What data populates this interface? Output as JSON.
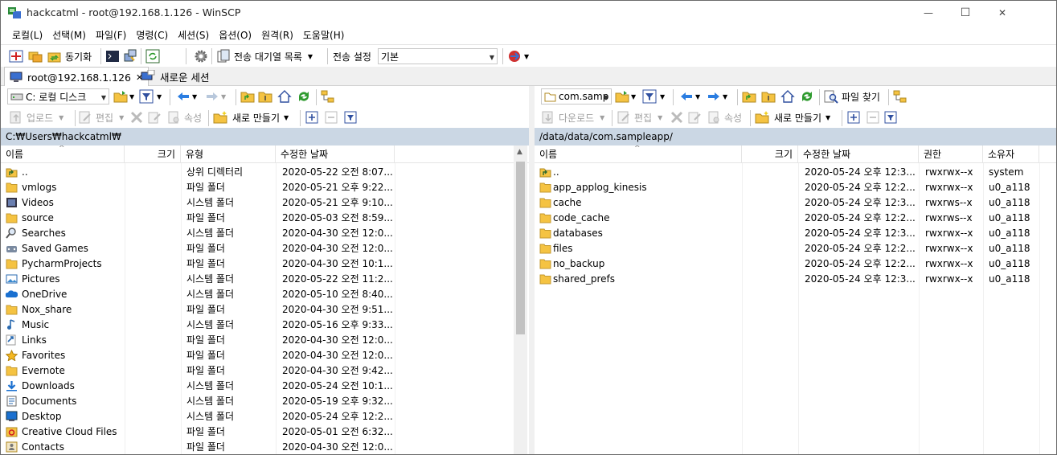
{
  "window": {
    "title": "hackcatml - root@192.168.1.126 - WinSCP",
    "minimize": "—",
    "maximize": "☐",
    "close": "✕"
  },
  "menu": [
    "로컬(L)",
    "선택(M)",
    "파일(F)",
    "명령(C)",
    "세션(S)",
    "옵션(O)",
    "원격(R)",
    "도움말(H)"
  ],
  "toolbar": {
    "sync_label": "동기화",
    "queue_label": "전송 대기열 목록",
    "transfer_settings_label": "전송 설정",
    "transfer_settings_value": "기본"
  },
  "tabs": {
    "session_tab": "root@192.168.1.126",
    "session_close": "✕",
    "new_session": "새로운 세션"
  },
  "left": {
    "drive": "C: 로컬 디스크",
    "upload_label": "업로드",
    "edit_label": "편집",
    "props_label": "속성",
    "new_label": "새로 만들기",
    "path": "C:₩Users₩hackcatml₩",
    "columns": [
      "이름",
      "크기",
      "유형",
      "수정한 날짜"
    ],
    "files": [
      {
        "name": "..",
        "type": "상위 디렉터리",
        "date": "2020-05-22  오전 8:07...",
        "icon": "parent-dir-icon"
      },
      {
        "name": "vmlogs",
        "type": "파일 폴더",
        "date": "2020-05-21  오후 9:22...",
        "icon": "folder-icon"
      },
      {
        "name": "Videos",
        "type": "시스템 폴더",
        "date": "2020-05-21  오후 9:10...",
        "icon": "videos-folder-icon"
      },
      {
        "name": "source",
        "type": "파일 폴더",
        "date": "2020-05-03  오전 8:59...",
        "icon": "folder-icon"
      },
      {
        "name": "Searches",
        "type": "시스템 폴더",
        "date": "2020-04-30  오전 12:0...",
        "icon": "searches-icon"
      },
      {
        "name": "Saved Games",
        "type": "파일 폴더",
        "date": "2020-04-30  오전 12:0...",
        "icon": "saved-games-icon"
      },
      {
        "name": "PycharmProjects",
        "type": "파일 폴더",
        "date": "2020-04-30  오전 10:1...",
        "icon": "folder-icon"
      },
      {
        "name": "Pictures",
        "type": "시스템 폴더",
        "date": "2020-05-22  오전 11:2...",
        "icon": "pictures-icon"
      },
      {
        "name": "OneDrive",
        "type": "시스템 폴더",
        "date": "2020-05-10  오전 8:40...",
        "icon": "onedrive-icon"
      },
      {
        "name": "Nox_share",
        "type": "파일 폴더",
        "date": "2020-04-30  오전 9:51...",
        "icon": "folder-icon"
      },
      {
        "name": "Music",
        "type": "시스템 폴더",
        "date": "2020-05-16  오후 9:33...",
        "icon": "music-icon"
      },
      {
        "name": "Links",
        "type": "파일 폴더",
        "date": "2020-04-30  오전 12:0...",
        "icon": "links-icon"
      },
      {
        "name": "Favorites",
        "type": "파일 폴더",
        "date": "2020-04-30  오전 12:0...",
        "icon": "favorites-icon"
      },
      {
        "name": "Evernote",
        "type": "파일 폴더",
        "date": "2020-04-30  오전 9:42...",
        "icon": "folder-icon"
      },
      {
        "name": "Downloads",
        "type": "시스템 폴더",
        "date": "2020-05-24  오전 10:1...",
        "icon": "downloads-icon"
      },
      {
        "name": "Documents",
        "type": "시스템 폴더",
        "date": "2020-05-19  오후 9:32...",
        "icon": "documents-icon"
      },
      {
        "name": "Desktop",
        "type": "시스템 폴더",
        "date": "2020-05-24  오후 12:2...",
        "icon": "desktop-icon"
      },
      {
        "name": "Creative Cloud Files",
        "type": "파일 폴더",
        "date": "2020-05-01  오전 6:32...",
        "icon": "creative-cloud-icon"
      },
      {
        "name": "Contacts",
        "type": "파일 폴더",
        "date": "2020-04-30  오전 12:0...",
        "icon": "contacts-icon"
      }
    ]
  },
  "right": {
    "dir": "com.samp",
    "download_label": "다운로드",
    "edit_label": "편집",
    "props_label": "속성",
    "new_label": "새로 만들기",
    "find_label": "파일 찾기",
    "path": "/data/data/com.sampleapp/",
    "columns": [
      "이름",
      "크기",
      "수정한 날짜",
      "권한",
      "소유자"
    ],
    "files": [
      {
        "name": "..",
        "date": "2020-05-24  오후 12:3...",
        "perm": "rwxrwx--x",
        "owner": "system",
        "icon": "parent-dir-icon"
      },
      {
        "name": "app_applog_kinesis",
        "date": "2020-05-24  오후 12:2...",
        "perm": "rwxrwx--x",
        "owner": "u0_a118",
        "icon": "folder-icon"
      },
      {
        "name": "cache",
        "date": "2020-05-24  오후 12:3...",
        "perm": "rwxrws--x",
        "owner": "u0_a118",
        "icon": "folder-icon"
      },
      {
        "name": "code_cache",
        "date": "2020-05-24  오후 12:2...",
        "perm": "rwxrws--x",
        "owner": "u0_a118",
        "icon": "folder-icon"
      },
      {
        "name": "databases",
        "date": "2020-05-24  오후 12:3...",
        "perm": "rwxrwx--x",
        "owner": "u0_a118",
        "icon": "folder-icon"
      },
      {
        "name": "files",
        "date": "2020-05-24  오후 12:2...",
        "perm": "rwxrwx--x",
        "owner": "u0_a118",
        "icon": "folder-icon"
      },
      {
        "name": "no_backup",
        "date": "2020-05-24  오후 12:2...",
        "perm": "rwxrwx--x",
        "owner": "u0_a118",
        "icon": "folder-icon"
      },
      {
        "name": "shared_prefs",
        "date": "2020-05-24  오후 12:3...",
        "perm": "rwxrwx--x",
        "owner": "u0_a118",
        "icon": "folder-icon"
      }
    ]
  },
  "colors": {
    "folder": "#f5c342",
    "path_bar": "#cbd7e4",
    "arrow_blue": "#2a7de1",
    "refresh_green": "#2e9a2e"
  }
}
